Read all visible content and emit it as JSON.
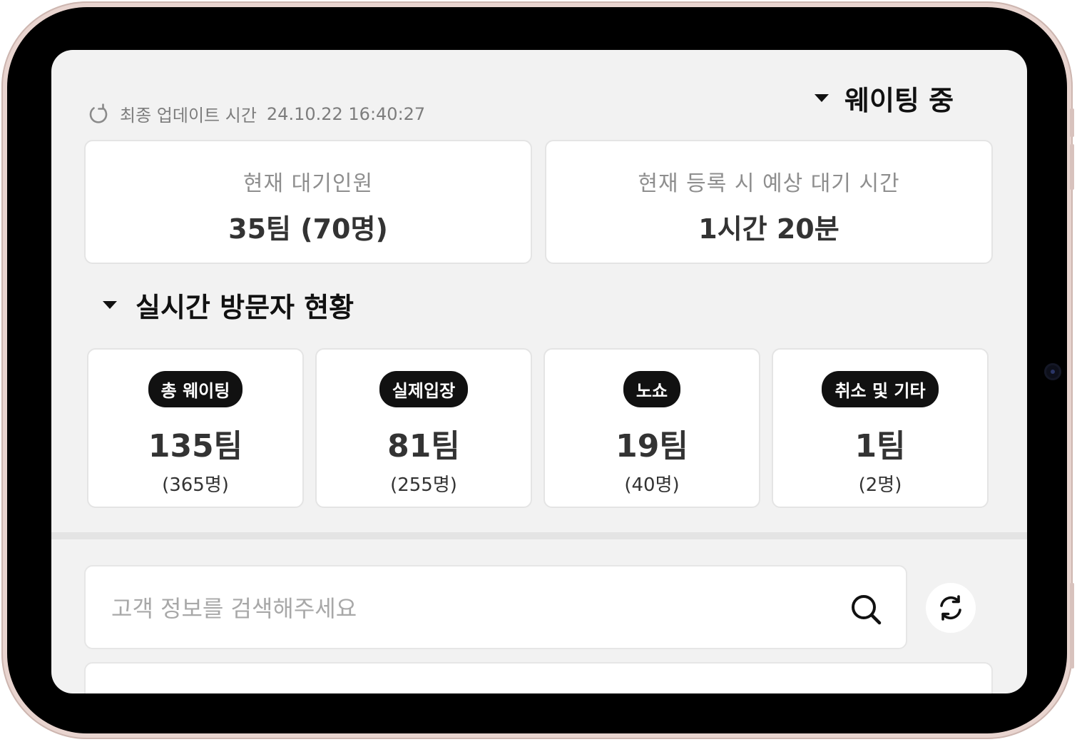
{
  "header": {
    "waiting_status": "웨이팅 중",
    "last_update_label": "최종 업데이트 시간",
    "last_update_time": "24.10.22 16:40:27"
  },
  "summary": {
    "current_waiting_label": "현재 대기인원",
    "current_waiting_value": "35팀 (70명)",
    "expected_wait_label": "현재 등록 시 예상 대기 시간",
    "expected_wait_value": "1시간 20분"
  },
  "realtime": {
    "title": "실시간 방문자 현황",
    "stats": [
      {
        "label": "총 웨이팅",
        "value": "135팀",
        "sub": "(365명)"
      },
      {
        "label": "실제입장",
        "value": "81팀",
        "sub": "(255명)"
      },
      {
        "label": "노쇼",
        "value": "19팀",
        "sub": "(40명)"
      },
      {
        "label": "취소 및 기타",
        "value": "1팀",
        "sub": "(2명)"
      }
    ]
  },
  "search": {
    "placeholder": "고객 정보를 검색해주세요",
    "value": ""
  },
  "icons": {
    "update": "refresh-small-icon",
    "search": "search-icon",
    "refresh": "refresh-icon",
    "caret": "caret-down-icon"
  },
  "colors": {
    "badge_bg": "#111111",
    "screen_bg": "#f2f2f2",
    "device_frame": "#e8d4cf"
  }
}
